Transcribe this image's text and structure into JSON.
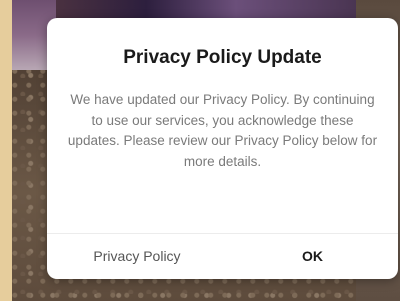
{
  "dialog": {
    "title": "Privacy Policy Update",
    "message": "We have updated our Privacy Policy. By continuing to use our services, you acknowledge these updates. Please review our Privacy Policy below for more details.",
    "buttons": {
      "privacy_policy_label": "Privacy Policy",
      "ok_label": "OK"
    }
  },
  "colors": {
    "dialog_background": "#ffffff",
    "title_text": "#1a1a1a",
    "message_text": "#7a7a7a"
  }
}
